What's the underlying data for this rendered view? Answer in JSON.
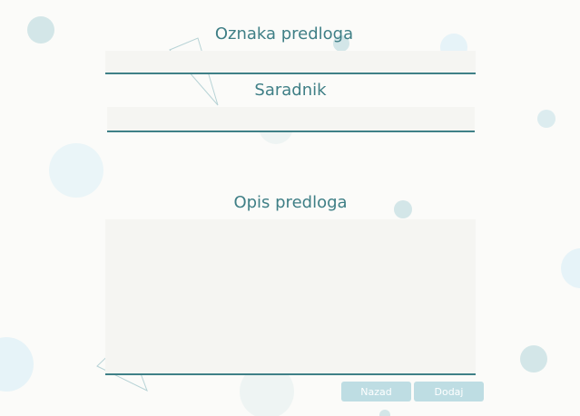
{
  "form": {
    "template_label": {
      "text": "Oznaka predloga"
    },
    "template_input": {
      "value": "",
      "placeholder": ""
    },
    "collaborator_label": {
      "text": "Saradnik"
    },
    "collaborator_input": {
      "value": "",
      "placeholder": ""
    },
    "description_label": {
      "text": "Opis predloga"
    },
    "description_input": {
      "value": "",
      "placeholder": ""
    }
  },
  "actions": {
    "back_label": "Nazad",
    "add_label": "Dodaj"
  },
  "colors": {
    "accent": "#3f8087",
    "label": "#3f7f86",
    "field_bg": "#f5f5f2",
    "button_bg": "#bedde3",
    "page_bg": "#fbfbf9"
  }
}
